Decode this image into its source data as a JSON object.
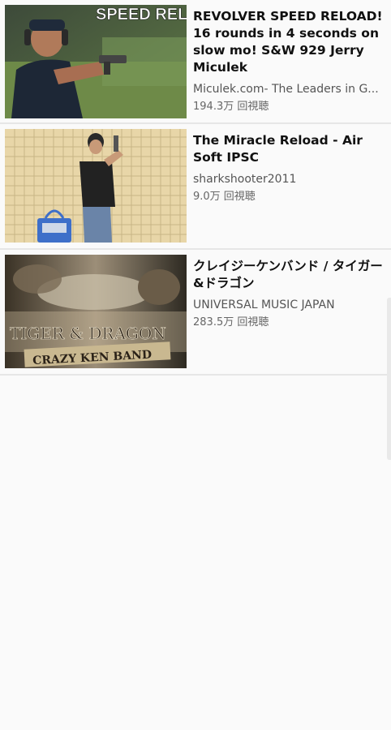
{
  "videos": [
    {
      "title": "REVOLVER SPEED RELOAD! 16 rounds in 4 seconds on slow mo! S&W 929 Jerry Miculek",
      "channel": "Miculek.com- The Leaders in G...",
      "views": "194.3万 回視聴",
      "thumbnail_text": "SPEED RELOAD"
    },
    {
      "title": "The Miracle Reload - Air Soft IPSC",
      "channel": "sharkshooter2011",
      "views": "9.0万 回視聴"
    },
    {
      "title": "クレイジーケンバンド / タイガー&ドラゴン",
      "channel": "UNIVERSAL MUSIC JAPAN",
      "views": "283.5万 回視聴",
      "thumbnail_text_1": "TIGER & DRAGON",
      "thumbnail_text_2": "CRAZY KEN BAND"
    }
  ]
}
